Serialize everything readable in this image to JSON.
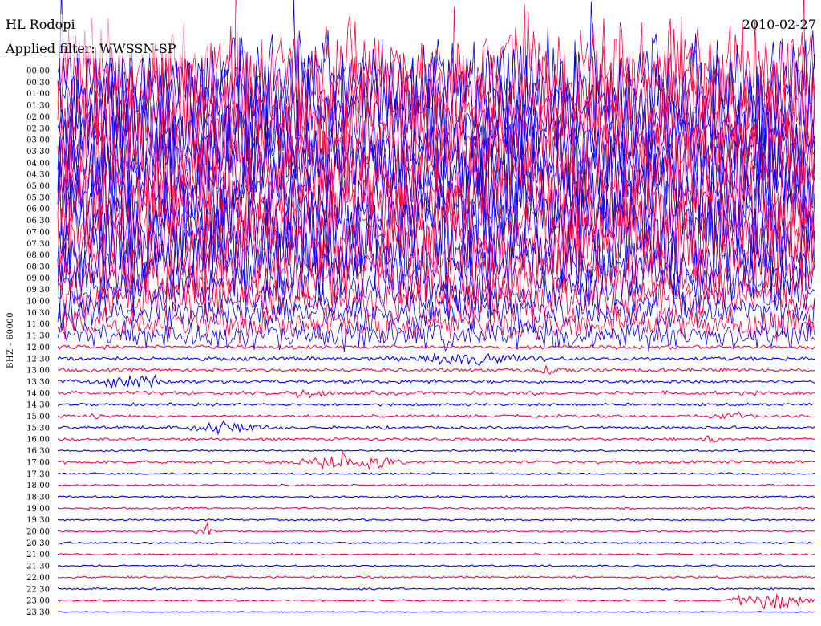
{
  "header": {
    "station": "HL Rodopi",
    "filter": "Applied filter: WWSSN-SP",
    "date": "2010-02-27"
  },
  "chart_data": {
    "type": "line",
    "title": "HL Rodopi",
    "subtitle": "Applied filter: WWSSN-SP",
    "date": "2010-02-27",
    "ylabel": "BHZ - 60000",
    "row_labels": [
      "00:00",
      "00:30",
      "01:00",
      "01:30",
      "02:00",
      "02:30",
      "03:00",
      "03:30",
      "04:00",
      "04:30",
      "05:00",
      "05:30",
      "06:00",
      "06:30",
      "07:00",
      "07:30",
      "08:00",
      "08:30",
      "09:00",
      "09:30",
      "10:00",
      "10:30",
      "11:00",
      "11:30",
      "12:00",
      "12:30",
      "13:00",
      "13:30",
      "14:00",
      "14:30",
      "15:00",
      "15:30",
      "16:00",
      "16:30",
      "17:00",
      "17:30",
      "18:00",
      "18:30",
      "19:00",
      "19:30",
      "20:00",
      "20:30",
      "21:00",
      "21:30",
      "22:00",
      "22:30",
      "23:00",
      "23:30"
    ],
    "row_colors": [
      "#ff0040",
      "#0000ff"
    ],
    "relative_amplitude": [
      1.0,
      1.0,
      1.0,
      1.0,
      1.0,
      1.0,
      1.0,
      1.0,
      1.0,
      1.0,
      1.0,
      1.0,
      1.0,
      1.0,
      1.0,
      0.95,
      0.9,
      0.75,
      0.6,
      0.5,
      0.45,
      0.4,
      0.35,
      0.3,
      0.04,
      0.04,
      0.04,
      0.04,
      0.04,
      0.03,
      0.03,
      0.03,
      0.03,
      0.02,
      0.03,
      0.02,
      0.02,
      0.02,
      0.02,
      0.02,
      0.02,
      0.02,
      0.02,
      0.02,
      0.02,
      0.02,
      0.02,
      0.01
    ],
    "events": [
      {
        "row": "12:30",
        "start_fraction": 0.45,
        "end_fraction": 0.65,
        "amplitude": 0.35
      },
      {
        "row": "13:00",
        "start_fraction": 0.6,
        "end_fraction": 0.7,
        "amplitude": 0.15
      },
      {
        "row": "13:30",
        "start_fraction": 0.04,
        "end_fraction": 0.15,
        "amplitude": 0.55
      },
      {
        "row": "14:00",
        "start_fraction": 0.3,
        "end_fraction": 0.36,
        "amplitude": 0.3
      },
      {
        "row": "15:00",
        "start_fraction": 0.04,
        "end_fraction": 0.06,
        "amplitude": 0.2
      },
      {
        "row": "15:00",
        "start_fraction": 0.86,
        "end_fraction": 0.92,
        "amplitude": 0.3
      },
      {
        "row": "15:30",
        "start_fraction": 0.14,
        "end_fraction": 0.3,
        "amplitude": 0.35
      },
      {
        "row": "16:00",
        "start_fraction": 0.85,
        "end_fraction": 0.88,
        "amplitude": 0.2
      },
      {
        "row": "17:00",
        "start_fraction": 0.31,
        "end_fraction": 0.46,
        "amplitude": 0.6
      },
      {
        "row": "20:00",
        "start_fraction": 0.18,
        "end_fraction": 0.21,
        "amplitude": 0.45
      },
      {
        "row": "23:00",
        "start_fraction": 0.88,
        "end_fraction": 1.0,
        "amplitude": 0.7
      }
    ]
  }
}
